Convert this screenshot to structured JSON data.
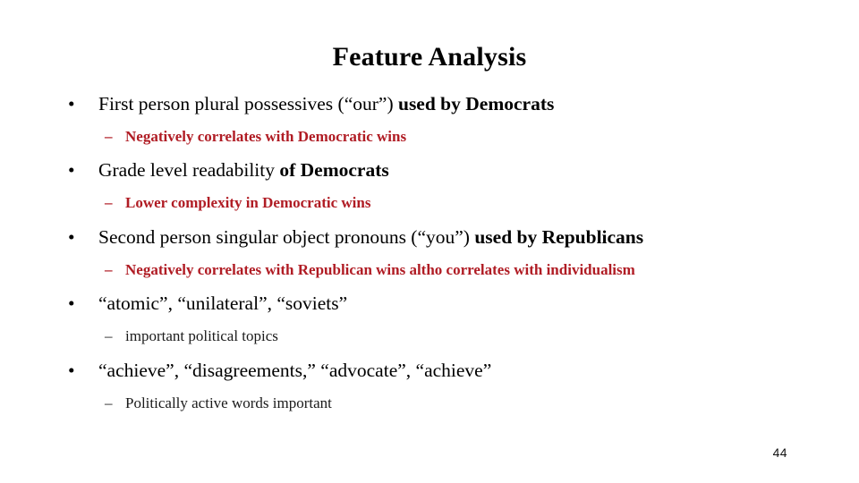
{
  "slide": {
    "title": "Feature Analysis",
    "page_number": "44",
    "background_color": "#ffffff",
    "accent_color": "#b01c24",
    "text_color": "#000000",
    "bullet_marker": "•",
    "sub_bullet_marker": "–"
  },
  "bullets": [
    {
      "marker": "•",
      "text_regular": "First person plural possessives (“our”) ",
      "text_bold": "used by Democrats",
      "sub": {
        "marker": "–",
        "text": "Negatively correlates with Democratic wins",
        "style": "red"
      }
    },
    {
      "marker": "•",
      "text_regular": "Grade level readability ",
      "text_bold": "of Democrats",
      "sub": {
        "marker": "–",
        "text": "Lower complexity in Democratic wins",
        "style": "red"
      }
    },
    {
      "marker": "•",
      "text_regular": "Second person singular object pronouns (“you”) ",
      "text_bold": "used by Republicans",
      "sub": {
        "marker": "–",
        "text": "Negatively correlates with Republican wins altho correlates with individualism",
        "style": "red"
      }
    },
    {
      "marker": "•",
      "text_regular": "“atomic”, “unilateral”, “soviets”",
      "text_bold": "",
      "sub": {
        "marker": "–",
        "text": "important political topics",
        "style": "plain"
      }
    },
    {
      "marker": "•",
      "text_regular": "“achieve”, “disagreements,” “advocate”, “achieve”",
      "text_bold": "",
      "sub": {
        "marker": "–",
        "text": "Politically active words important",
        "style": "plain"
      }
    }
  ]
}
